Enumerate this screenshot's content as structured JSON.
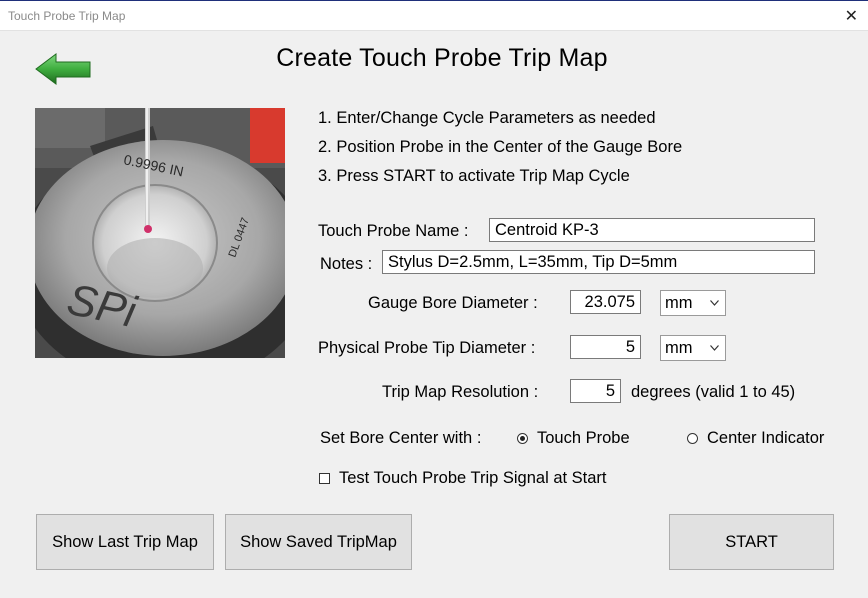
{
  "window": {
    "title": "Touch Probe Trip Map",
    "close_glyph": "✕"
  },
  "header": {
    "back_icon": "green-left-arrow-icon",
    "title": "Create Touch Probe Trip Map"
  },
  "image": {
    "ring_text_1": "0.9996 IN",
    "ring_text_2": "DL 0447",
    "logo": "SPi"
  },
  "instructions": [
    "1. Enter/Change Cycle Parameters as needed",
    "2. Position Probe in the Center of the Gauge Bore",
    "3. Press START to activate Trip Map Cycle"
  ],
  "form": {
    "probe_name_label": "Touch Probe Name :",
    "probe_name_value": "Centroid KP-3",
    "notes_label": "Notes :",
    "notes_value": "Stylus D=2.5mm, L=35mm, Tip D=5mm",
    "bore_diameter_label": "Gauge Bore Diameter :",
    "bore_diameter_value": "23.075",
    "bore_diameter_unit": "mm",
    "tip_diameter_label": "Physical Probe Tip Diameter :",
    "tip_diameter_value": "5",
    "tip_diameter_unit": "mm",
    "resolution_label": "Trip Map Resolution :",
    "resolution_value": "5",
    "resolution_suffix": "degrees (valid 1 to 45)",
    "bore_center_label": "Set Bore Center with :",
    "bore_center_options": [
      {
        "label": "Touch Probe",
        "selected": true
      },
      {
        "label": "Center Indicator",
        "selected": false
      }
    ],
    "test_signal_label": "Test Touch Probe Trip Signal at Start",
    "test_signal_checked": false
  },
  "buttons": {
    "show_last": "Show Last Trip Map",
    "show_saved": "Show Saved TripMap",
    "start": "START"
  },
  "colors": {
    "arrow_green": "#3fae3f",
    "arrow_dark": "#1f6b1f",
    "background": "#f0f0f0"
  }
}
